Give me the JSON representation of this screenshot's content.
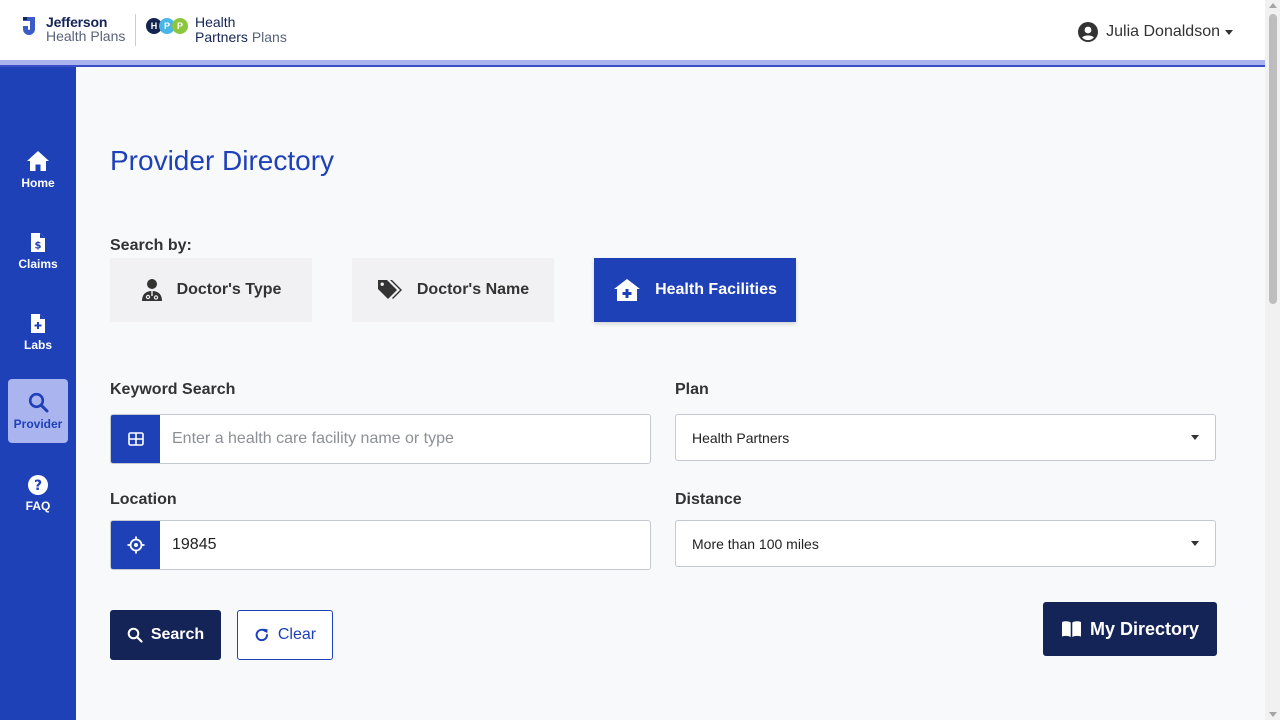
{
  "header": {
    "logo1": {
      "line1": "Jefferson",
      "line2": "Health Plans"
    },
    "logo2": {
      "dots": [
        "H",
        "P",
        "P"
      ],
      "line1": "Health",
      "line2a": "Partners",
      "line2b": "Plans"
    },
    "user": {
      "name": "Julia Donaldson"
    }
  },
  "sidebar": {
    "items": [
      {
        "label": "Home",
        "icon": "home-icon"
      },
      {
        "label": "Claims",
        "icon": "claims-icon"
      },
      {
        "label": "Labs",
        "icon": "labs-icon"
      },
      {
        "label": "Provider",
        "icon": "search-icon",
        "active": true
      },
      {
        "label": "FAQ",
        "icon": "question-icon"
      }
    ]
  },
  "main": {
    "title": "Provider Directory",
    "search_by_label": "Search by:",
    "tabs": [
      {
        "label": "Doctor's Type",
        "icon": "doctor-icon"
      },
      {
        "label": "Doctor's Name",
        "icon": "tags-icon"
      },
      {
        "label": "Health Facilities",
        "icon": "clinic-icon",
        "active": true
      }
    ],
    "keyword": {
      "label": "Keyword Search",
      "placeholder": "Enter a health care facility name or type",
      "value": ""
    },
    "location": {
      "label": "Location",
      "value": "19845"
    },
    "plan": {
      "label": "Plan",
      "value": "Health Partners"
    },
    "distance": {
      "label": "Distance",
      "value": "More than 100 miles"
    },
    "buttons": {
      "search": "Search",
      "clear": "Clear",
      "my_directory": "My Directory"
    }
  },
  "colors": {
    "primary": "#1f41b8",
    "navy": "#152456",
    "active_nav": "#aab5f0"
  }
}
